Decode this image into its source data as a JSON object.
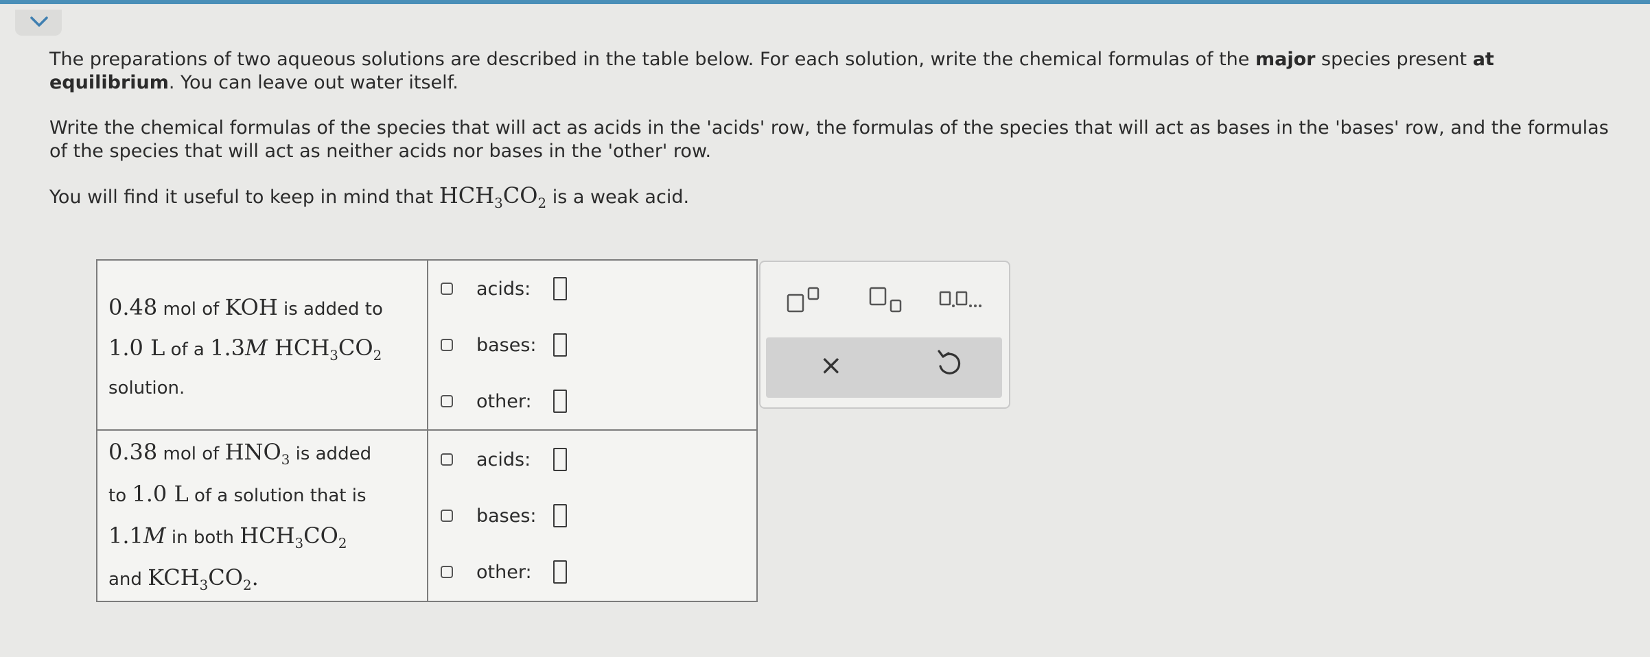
{
  "instructions": {
    "p1": "The preparations of two aqueous solutions are described in the table below. For each solution, write the chemical formulas of the ",
    "p1_bold1": "major",
    "p1_mid": " species present ",
    "p1_bold2": "at equilibrium",
    "p1_end": ". You can leave out water itself.",
    "p2": "Write the chemical formulas of the species that will act as acids in the 'acids' row, the formulas of the species that will act as bases in the 'bases' row, and the formulas of the species that will act as neither acids nor bases in the 'other' row.",
    "p3_before": "You will find it useful to keep in mind that ",
    "p3_acid_main": "HCH",
    "p3_acid_sub1": "3",
    "p3_acid_mid": "CO",
    "p3_acid_sub2": "2",
    "p3_after": " is a weak acid."
  },
  "solutions": [
    {
      "amount": "0.48",
      "mol_of": " mol of ",
      "base": "KOH",
      "added_to": " is added to",
      "volume": "1.0 L",
      "of_a": " of a ",
      "conc": "1.3",
      "molar": "M",
      "acid_main": " HCH",
      "acid_sub1": "3",
      "acid_mid": "CO",
      "acid_sub2": "2",
      "end": "solution."
    },
    {
      "amount": "0.38",
      "mol_of": " mol of ",
      "acid": "HNO",
      "acid_sub": "3",
      "added": " is added",
      "to": "to ",
      "volume": "1.0 L",
      "of_sol": " of a solution that is",
      "conc": "1.1",
      "molar": "M",
      "in_both": " in both ",
      "c1_main": "HCH",
      "c1_sub1": "3",
      "c1_mid": "CO",
      "c1_sub2": "2",
      "and": "and ",
      "c2_main": "KCH",
      "c2_sub1": "3",
      "c2_mid": "CO",
      "c2_sub2": "2",
      "period": "."
    }
  ],
  "answer_labels": {
    "acids": "acids:",
    "bases": "bases:",
    "other": "other:"
  },
  "palette": {
    "superscript": "superscript-button",
    "subscript": "subscript-button",
    "list": "list-button",
    "clear_symbol": "×",
    "undo_icon": "undo-icon"
  }
}
